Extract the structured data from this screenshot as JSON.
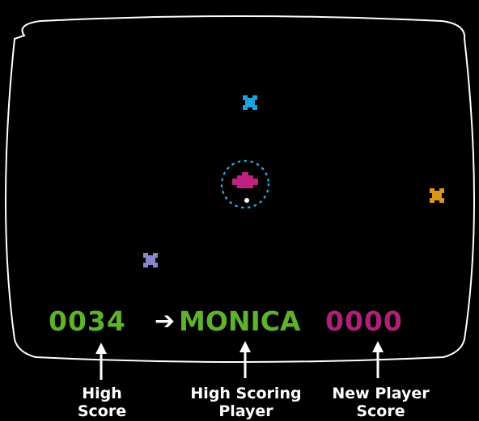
{
  "hud": {
    "high_score": "0034",
    "arrow": "➔",
    "high_scoring_player": "MONICA",
    "new_player_score": "0000"
  },
  "captions": {
    "high_score": [
      "High",
      "Score"
    ],
    "high_scoring_player": [
      "High Scoring",
      "Player"
    ],
    "new_player_score": [
      "New Player",
      "Score"
    ]
  },
  "colors": {
    "background": "#000000",
    "screen_border": "#ffffff",
    "score_green": "#5fb22c",
    "score_magenta": "#b0207a",
    "ship": "#c0207e",
    "shield": "#2aa6d8",
    "enemy_cyan": "#1ea0dc",
    "enemy_orange": "#d8961c",
    "enemy_lavender": "#8a86cc"
  },
  "sprites": {
    "player_ship": "ship-icon",
    "enemies": [
      "enemy-cyan-icon",
      "enemy-orange-icon",
      "enemy-lavender-icon"
    ]
  }
}
